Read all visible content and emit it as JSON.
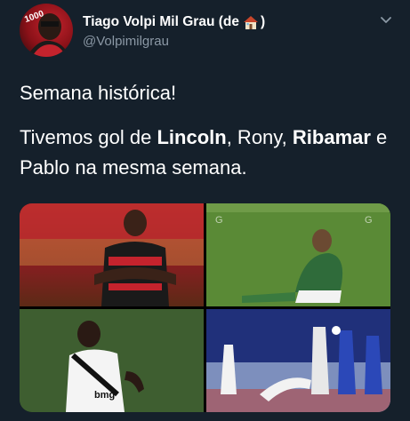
{
  "tweet": {
    "author": {
      "display_name": "Tiago Volpi Mil Grau (de",
      "display_name_suffix": ")",
      "handle": "@Volpimilgrau"
    },
    "text_line1": "Semana histórica!",
    "text_parts": {
      "p1": "Tivemos gol de ",
      "b1": "Lincoln",
      "p2": ", Rony, ",
      "b2": "Ribamar",
      "p3": " e Pablo na mesma semana."
    },
    "media": {
      "photos": [
        {
          "name": "photo-flamengo-player",
          "jersey_text": ""
        },
        {
          "name": "photo-palmeiras-player",
          "jersey_text": ""
        },
        {
          "name": "photo-vasco-player",
          "jersey_text": "bmg"
        },
        {
          "name": "photo-sao-paulo-match",
          "jersey_text": ""
        }
      ]
    }
  },
  "colors": {
    "background": "#15202b",
    "secondary_text": "#8b98a5",
    "primary_text": "#ffffff"
  },
  "icons": {
    "house": "house-icon",
    "chevron": "chevron-down-icon"
  }
}
